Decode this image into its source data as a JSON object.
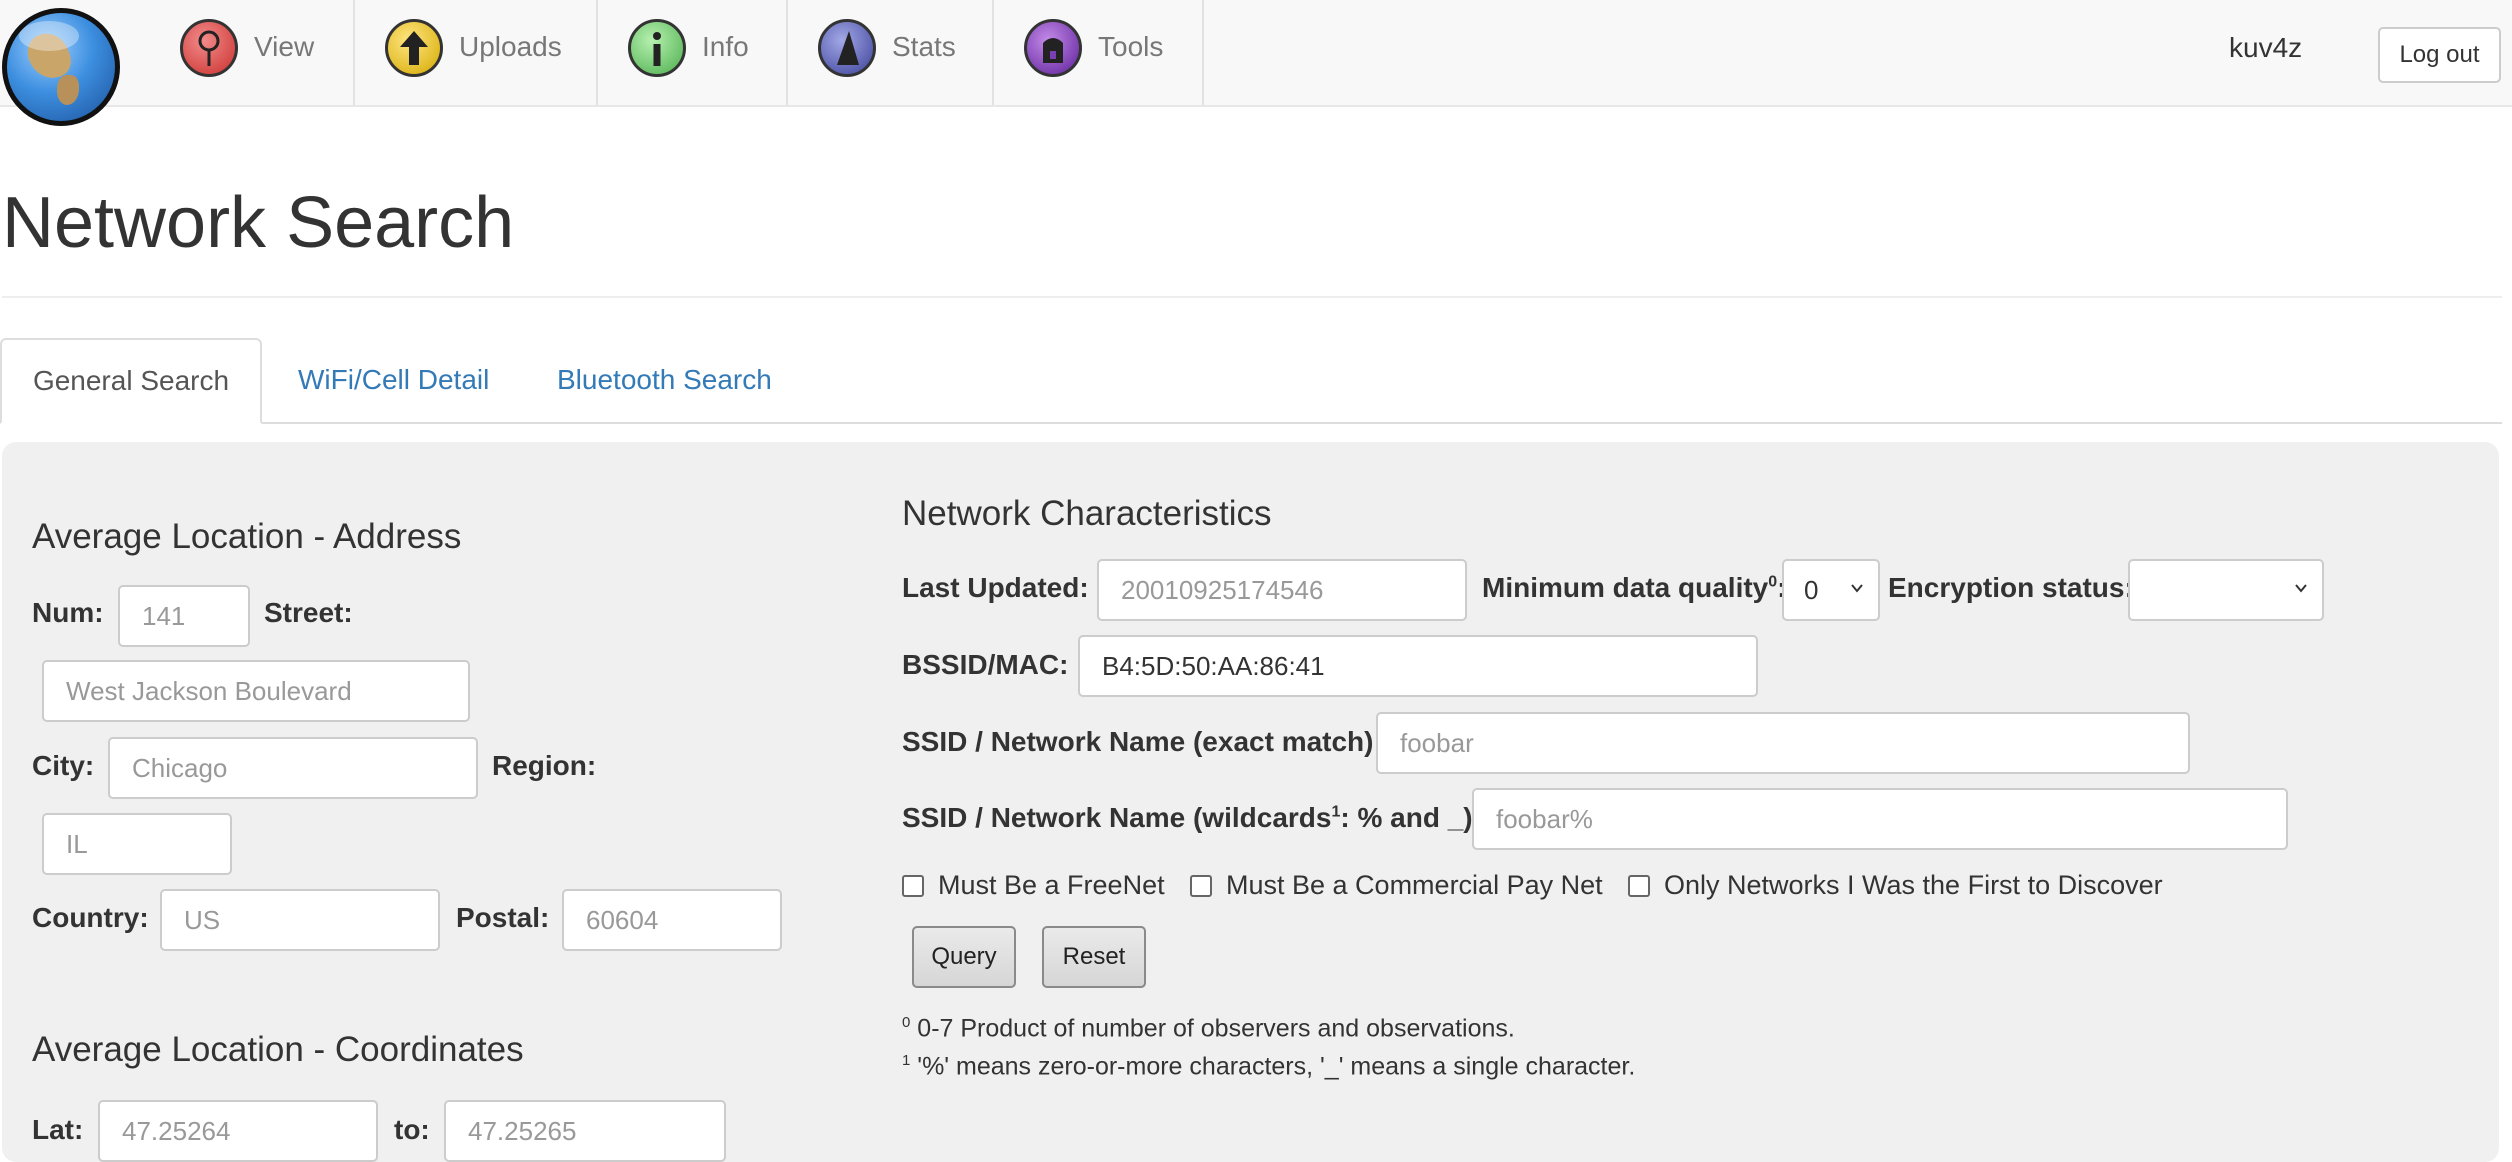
{
  "nav": {
    "items": [
      {
        "label": "View",
        "icon": "view-icon",
        "color": "#d9534f"
      },
      {
        "label": "Uploads",
        "icon": "upload-icon",
        "color": "#e6b800"
      },
      {
        "label": "Info",
        "icon": "info-icon",
        "color": "#5cb85c"
      },
      {
        "label": "Stats",
        "icon": "stats-icon",
        "color": "#5b62b5"
      },
      {
        "label": "Tools",
        "icon": "tools-icon",
        "color": "#7b3fb5"
      }
    ],
    "username": "kuv4z",
    "logout_label": "Log out"
  },
  "page": {
    "title": "Network Search"
  },
  "tabs": [
    {
      "label": "General Search",
      "active": true
    },
    {
      "label": "WiFi/Cell Detail",
      "active": false
    },
    {
      "label": "Bluetooth Search",
      "active": false
    }
  ],
  "address": {
    "title": "Average Location - Address",
    "num": {
      "label": "Num:",
      "placeholder": "141"
    },
    "street": {
      "label": "Street:",
      "placeholder": "West Jackson Boulevard"
    },
    "city": {
      "label": "City:",
      "placeholder": "Chicago"
    },
    "region": {
      "label": "Region:",
      "placeholder": "IL"
    },
    "country": {
      "label": "Country:",
      "placeholder": "US"
    },
    "postal": {
      "label": "Postal:",
      "placeholder": "60604"
    }
  },
  "coordinates": {
    "title": "Average Location - Coordinates",
    "lat": {
      "label": "Lat:",
      "placeholder": "47.25264"
    },
    "to": {
      "label": "to:",
      "placeholder": "47.25265"
    }
  },
  "network": {
    "title": "Network Characteristics",
    "last_updated": {
      "label": "Last Updated:",
      "placeholder": "20010925174546"
    },
    "min_quality": {
      "label": "Minimum data quality",
      "sup": "0",
      "suffix": ":",
      "value": "0"
    },
    "encryption": {
      "label": "Encryption status:",
      "value": ""
    },
    "bssid": {
      "label": "BSSID/MAC:",
      "value": "B4:5D:50:AA:86:41"
    },
    "ssid_exact": {
      "label": "SSID / Network Name (exact match):",
      "placeholder": "foobar"
    },
    "ssid_wild": {
      "label_pre": "SSID / Network Name (wildcards",
      "sup": "1",
      "label_post": ": % and _):",
      "placeholder": "foobar%"
    },
    "checkboxes": [
      {
        "label": "Must Be a FreeNet",
        "checked": false
      },
      {
        "label": "Must Be a Commercial Pay Net",
        "checked": false
      },
      {
        "label": "Only Networks I Was the First to Discover",
        "checked": false
      }
    ],
    "query_label": "Query",
    "reset_label": "Reset",
    "notes": [
      {
        "sup": "0",
        "text": " 0-7 Product of number of observers and observations."
      },
      {
        "sup": "1",
        "text": " '%' means zero-or-more characters, '_' means a single character."
      }
    ]
  }
}
